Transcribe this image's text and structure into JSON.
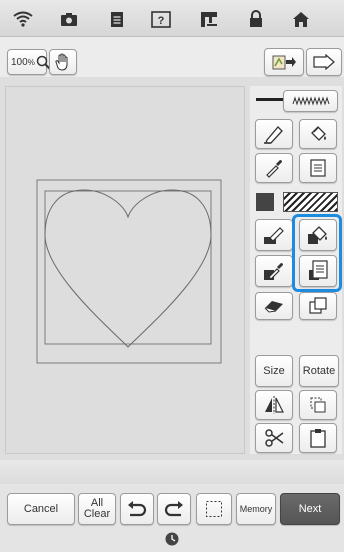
{
  "topbar": {
    "icons": [
      "wifi-icon",
      "camera-icon",
      "document-icon",
      "help-icon",
      "machine-icon",
      "lock-icon",
      "home-icon"
    ]
  },
  "toolbar": {
    "zoom_value": "100",
    "zoom_unit": "%"
  },
  "panel": {
    "size_label": "Size",
    "rotate_label": "Rotate"
  },
  "bottom": {
    "cancel_label": "Cancel",
    "all_clear_line1": "All",
    "all_clear_line2": "Clear",
    "memory_label": "Memory",
    "next_label": "Next"
  },
  "colors": {
    "accent_highlight": "#1c8be0",
    "next_button": "#5a5a5a"
  }
}
